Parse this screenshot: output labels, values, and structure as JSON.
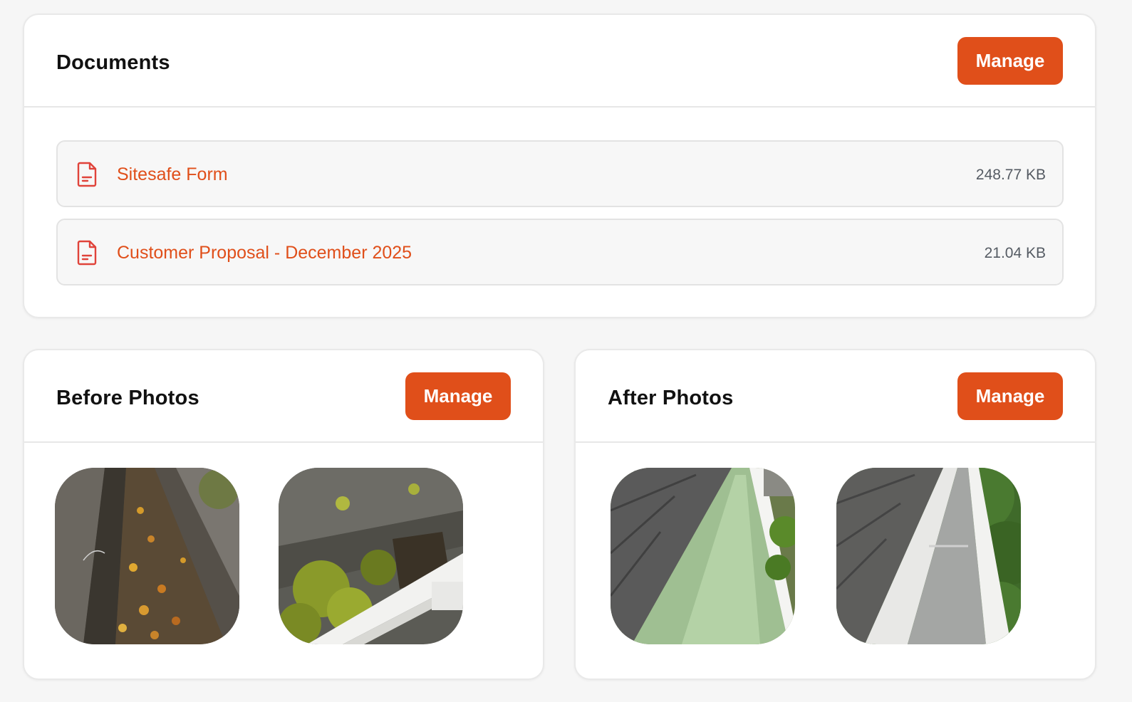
{
  "documents": {
    "title": "Documents",
    "manage_label": "Manage",
    "items": [
      {
        "name": "Sitesafe Form",
        "size": "248.77 KB",
        "icon": "pdf-file-icon"
      },
      {
        "name": "Customer Proposal - December 2025",
        "size": "21.04 KB",
        "icon": "pdf-file-icon"
      }
    ]
  },
  "before_photos": {
    "title": "Before Photos",
    "manage_label": "Manage",
    "photos": [
      {
        "alt": "Gutter filled with leaves and debris"
      },
      {
        "alt": "Mossy roof tiles above gutter"
      }
    ]
  },
  "after_photos": {
    "title": "After Photos",
    "manage_label": "Manage",
    "photos": [
      {
        "alt": "Clean gutter along shingle roof"
      },
      {
        "alt": "Clean white gutter with trees"
      }
    ]
  },
  "colors": {
    "accent": "#e04f1a",
    "background": "#f6f6f6",
    "card": "#ffffff",
    "muted_text": "#555b63"
  }
}
